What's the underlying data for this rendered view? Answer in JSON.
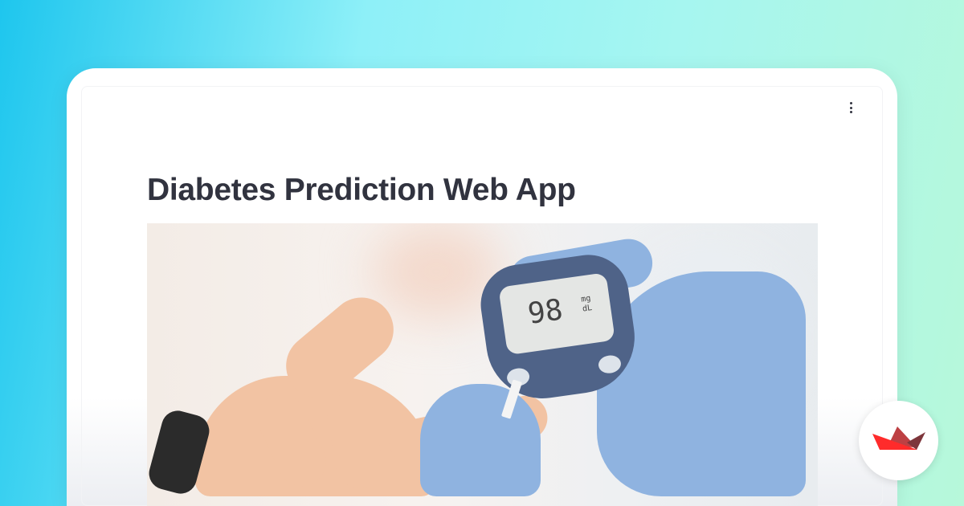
{
  "app": {
    "title": "Diabetes Prediction Web App",
    "menu_icon": "vertical-ellipsis-icon",
    "brand_logo": "streamlit-crown-logo"
  },
  "photo": {
    "reading_value": "98",
    "reading_unit_top": "mg",
    "reading_unit_bottom": "dL"
  },
  "colors": {
    "logo_red": "#ff2b2b",
    "logo_mid": "#bd4043",
    "logo_dark": "#7d353b",
    "title": "#31333f"
  }
}
